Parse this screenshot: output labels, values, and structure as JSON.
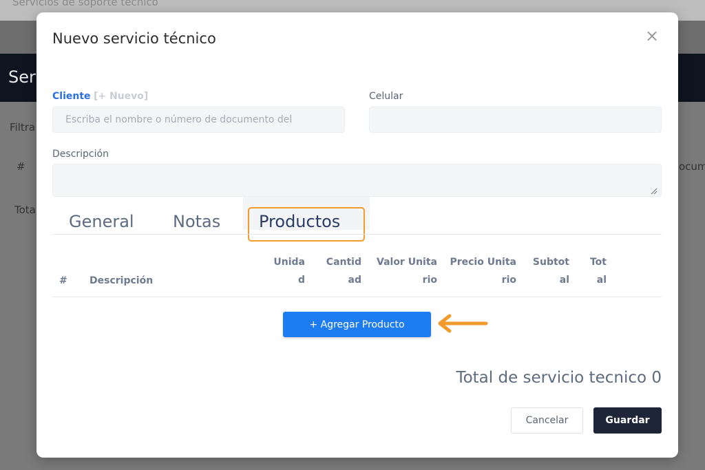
{
  "background": {
    "topbar_text": "Servicios de soporte técnico",
    "header_title": "Ser",
    "filter_label": "Filtra",
    "hash": "#",
    "total_label": "Tota",
    "right_cut": "ocum"
  },
  "modal": {
    "title": "Nuevo servicio técnico",
    "close_glyph": "×",
    "client_label": "Cliente",
    "client_new": "[+ Nuevo]",
    "client_placeholder": "Escriba el nombre o número de documento del",
    "phone_label": "Celular",
    "phone_value": "",
    "description_label": "Descripción",
    "description_value": ""
  },
  "tabs": [
    {
      "label": "General",
      "active": false
    },
    {
      "label": "Notas",
      "active": false
    },
    {
      "label": "Productos",
      "active": true
    }
  ],
  "table": {
    "columns": [
      {
        "l1": "#",
        "l2": ""
      },
      {
        "l1": "Descripción",
        "l2": ""
      },
      {
        "l1": "Unida",
        "l2": "d"
      },
      {
        "l1": "Cantid",
        "l2": "ad"
      },
      {
        "l1": "Valor Unita",
        "l2": "rio"
      },
      {
        "l1": "Precio Unita",
        "l2": "rio"
      },
      {
        "l1": "Subtot",
        "l2": "al"
      },
      {
        "l1": "Tot",
        "l2": "al"
      }
    ],
    "rows": []
  },
  "add_product_label": "+ Agregar Producto",
  "total_text": "Total de servicio tecnico 0",
  "buttons": {
    "cancel": "Cancelar",
    "save": "Guardar"
  },
  "colors": {
    "accent_blue": "#1e7cf2",
    "highlight_orange": "#f39a2c",
    "dark_navy": "#1f2538"
  }
}
